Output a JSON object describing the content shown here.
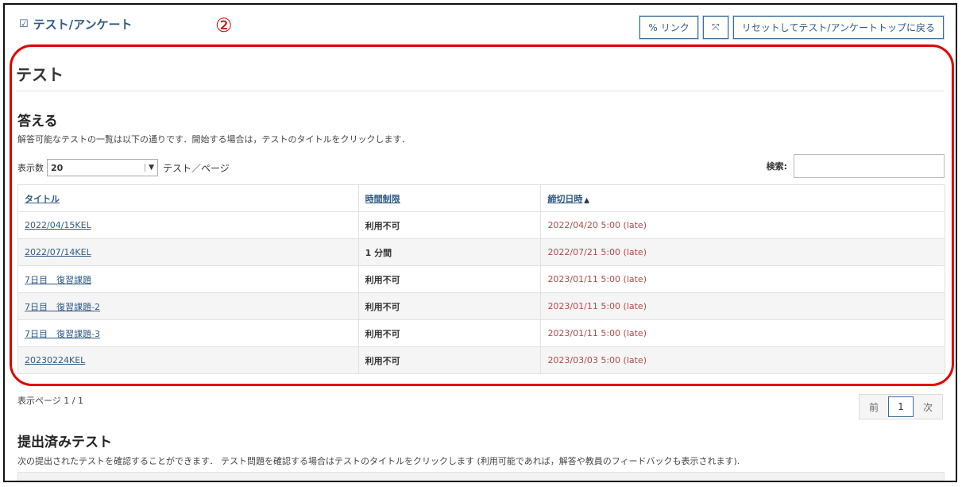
{
  "tool": {
    "title": "テスト/アンケート",
    "check_icon": "check-square-icon"
  },
  "callout_number": "②",
  "header_buttons": {
    "link_label": "リンク",
    "link_icon": "link-icon",
    "expand_icon": "expand-icon",
    "reset_label": "リセットしてテスト/アンケートトップに戻る"
  },
  "section": {
    "title": "テスト",
    "answer_heading": "答える",
    "instruction": "解答可能なテストの一覧は以下の通りです．開始する場合は，テストのタイトルをクリックします．"
  },
  "page_size": {
    "label": "表示数",
    "value": "20",
    "after": "テスト／ページ"
  },
  "search": {
    "label": "検索:",
    "value": ""
  },
  "table": {
    "headers": {
      "title": "タイトル",
      "limit": "時間制限",
      "due": "締切日時"
    },
    "rows": [
      {
        "title": "2022/04/15KEL",
        "limit": "利用不可",
        "due": "2022/04/20 5:00 (late)"
      },
      {
        "title": "2022/07/14KEL",
        "limit": "1 分間",
        "due": "2022/07/21 5:00 (late)"
      },
      {
        "title": "7日目　復習課題",
        "limit": "利用不可",
        "due": "2023/01/11 5:00 (late)"
      },
      {
        "title": "7日目　復習課題-2",
        "limit": "利用不可",
        "due": "2023/01/11 5:00 (late)"
      },
      {
        "title": "7日目　復習課題-3",
        "limit": "利用不可",
        "due": "2023/01/11 5:00 (late)"
      },
      {
        "title": "20230224KEL",
        "limit": "利用不可",
        "due": "2023/03/03 5:00 (late)"
      }
    ]
  },
  "pagination": {
    "info": "表示ページ 1 / 1",
    "prev": "前",
    "current": "1",
    "next": "次"
  },
  "submitted": {
    "heading": "提出済みテスト",
    "instruction": "次の提出されたテストを確認することができます． テスト問題を確認する場合はテストのタイトルをクリックします (利用可能であれば，解答や教員のフィードバックも表示されます)."
  },
  "colors": {
    "accent": "#2e5a86",
    "highlight": "#e00000",
    "late": "#b04a4a"
  }
}
